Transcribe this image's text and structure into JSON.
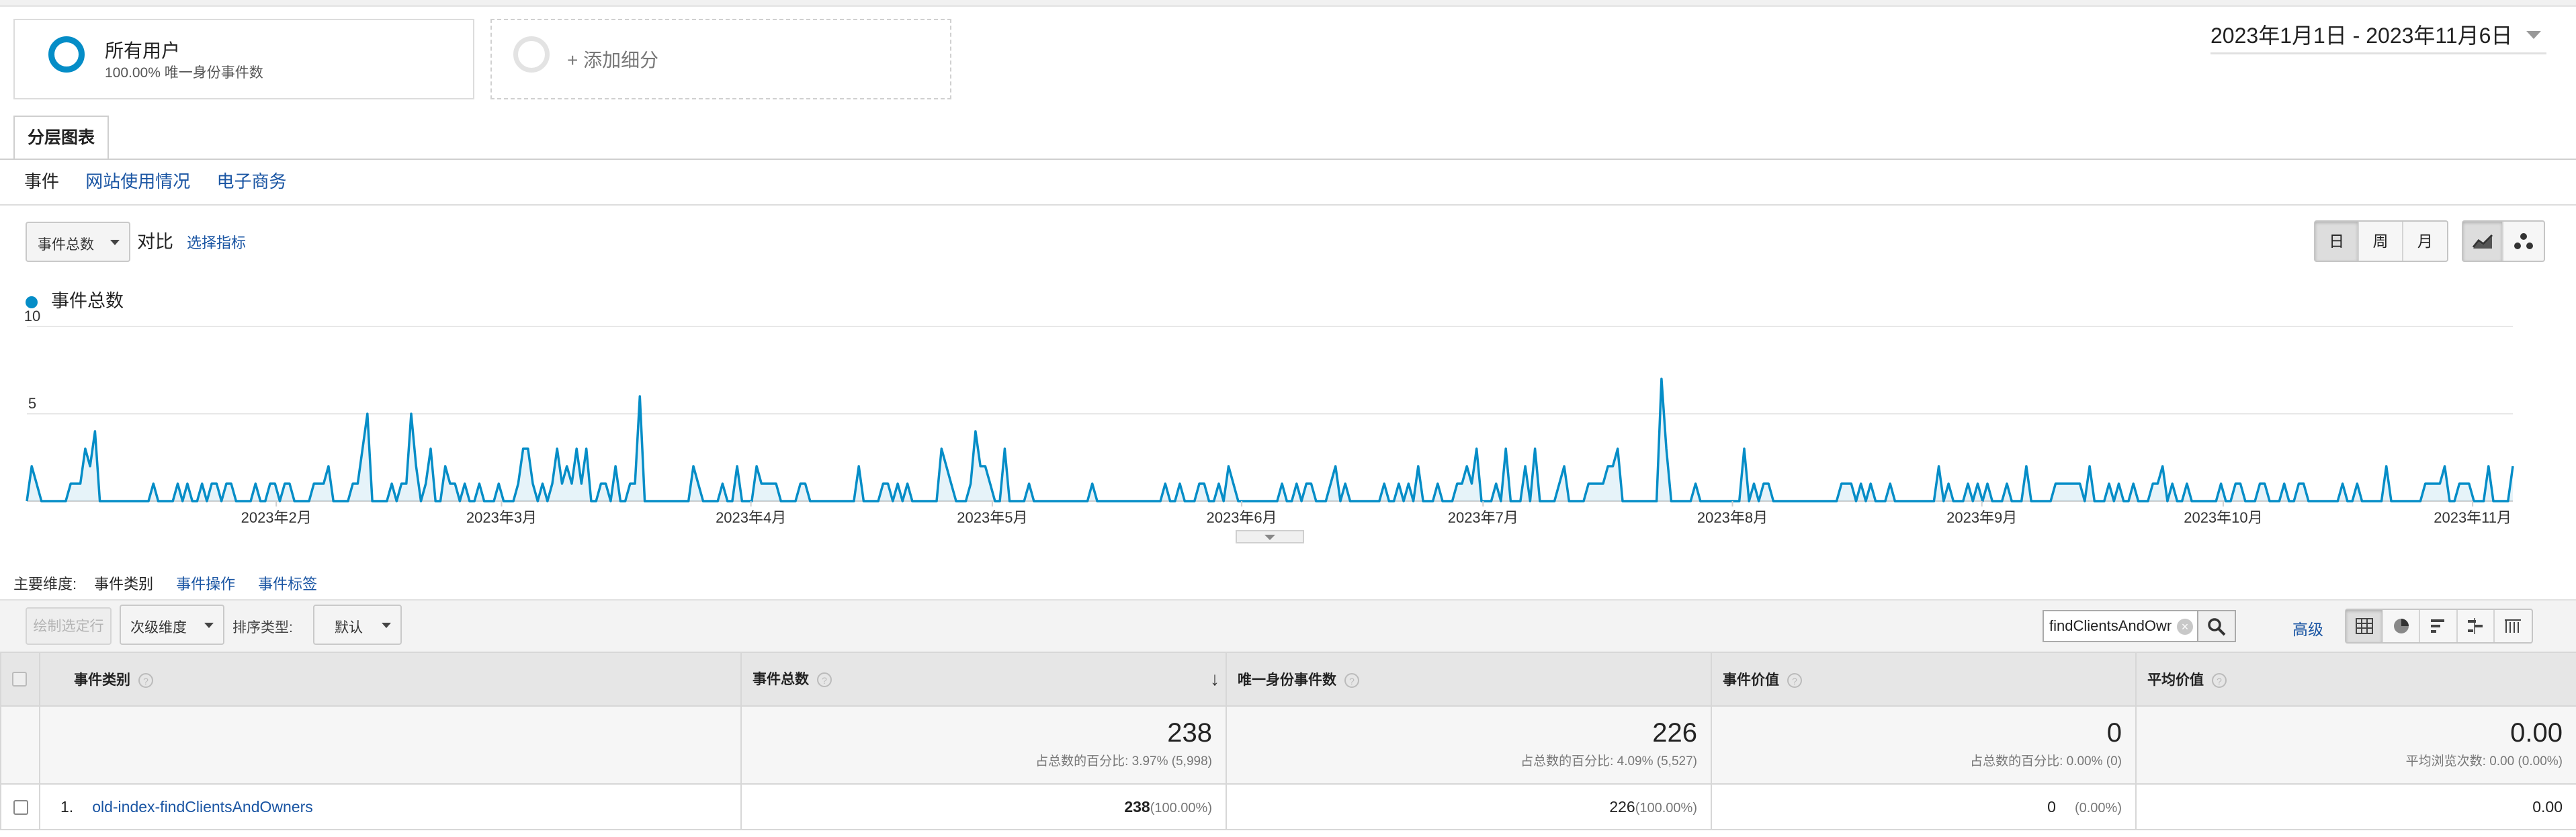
{
  "segments": {
    "active": {
      "name": "所有用户",
      "subtitle": "100.00% 唯一身份事件数"
    },
    "add_label": "+ 添加细分"
  },
  "date_range": "2023年1月1日 - 2023年11月6日",
  "tabs": [
    "分层图表"
  ],
  "subnav": [
    "事件",
    "网站使用情况",
    "电子商务"
  ],
  "chart_controls": {
    "metric": "事件总数",
    "vs_label": "对比",
    "select_metric": "选择指标",
    "granularity": [
      "日",
      "周",
      "月"
    ],
    "granularity_selected": "日"
  },
  "chart_data": {
    "type": "area",
    "series": [
      {
        "name": "事件总数",
        "color": "#058dc7",
        "values": [
          0,
          2,
          1,
          0,
          0,
          0,
          0,
          0,
          0,
          1,
          1,
          1,
          3,
          2,
          4,
          0,
          0,
          0,
          0,
          0,
          0,
          0,
          0,
          0,
          0,
          0,
          1,
          0,
          0,
          0,
          0,
          1,
          0,
          1,
          0,
          0,
          1,
          0,
          1,
          1,
          0,
          1,
          1,
          0,
          0,
          0,
          0,
          1,
          0,
          0,
          1,
          1,
          0,
          1,
          1,
          0,
          0,
          0,
          0,
          1,
          1,
          1,
          2,
          0,
          0,
          0,
          0,
          1,
          1,
          3,
          5,
          0,
          0,
          0,
          0,
          1,
          0,
          1,
          1,
          5,
          2,
          0,
          1,
          3,
          0,
          0,
          2,
          1,
          1,
          0,
          1,
          0,
          0,
          1,
          0,
          0,
          0,
          1,
          0,
          0,
          0,
          1,
          3,
          3,
          1,
          0,
          1,
          0,
          1,
          3,
          1,
          2,
          1,
          3,
          1,
          3,
          0,
          0,
          1,
          1,
          0,
          2,
          0,
          0,
          1,
          1,
          6,
          0,
          0,
          0,
          0,
          0,
          0,
          0,
          0,
          0,
          0,
          2,
          1,
          0,
          0,
          0,
          0,
          1,
          0,
          0,
          2,
          0,
          0,
          0,
          2,
          1,
          1,
          1,
          1,
          0,
          0,
          0,
          0,
          1,
          1,
          0,
          0,
          0,
          0,
          0,
          0,
          0,
          0,
          0,
          0,
          2,
          0,
          0,
          0,
          0,
          1,
          1,
          0,
          1,
          0,
          1,
          0,
          0,
          0,
          0,
          0,
          0,
          3,
          2,
          1,
          0,
          0,
          0,
          1,
          4,
          2,
          2,
          1,
          0,
          0,
          3,
          0,
          0,
          0,
          0,
          1,
          0,
          0,
          0,
          0,
          0,
          0,
          0,
          0,
          0,
          0,
          0,
          0,
          1,
          0,
          0,
          0,
          0,
          0,
          0,
          0,
          0,
          0,
          0,
          0,
          0,
          0,
          0,
          1,
          0,
          0,
          1,
          0,
          0,
          0,
          1,
          1,
          0,
          0,
          1,
          0,
          2,
          1,
          0,
          0,
          0,
          0,
          0,
          0,
          0,
          0,
          0,
          1,
          0,
          0,
          1,
          0,
          1,
          1,
          0,
          0,
          0,
          1,
          2,
          0,
          1,
          0,
          0,
          0,
          0,
          0,
          0,
          0,
          1,
          0,
          0,
          1,
          0,
          1,
          0,
          2,
          0,
          0,
          0,
          1,
          0,
          0,
          0,
          1,
          1,
          2,
          1,
          3,
          0,
          0,
          0,
          1,
          0,
          3,
          0,
          0,
          0,
          2,
          0,
          3,
          0,
          0,
          0,
          0,
          1,
          2,
          0,
          0,
          0,
          0,
          1,
          1,
          1,
          1,
          2,
          2,
          3,
          0,
          0,
          0,
          0,
          0,
          0,
          0,
          0,
          7,
          3,
          0,
          0,
          0,
          0,
          0,
          1,
          0,
          0,
          0,
          0,
          0,
          0,
          0,
          0,
          0,
          3,
          0,
          1,
          0,
          1,
          1,
          0,
          0,
          0,
          0,
          0,
          0,
          0,
          0,
          0,
          0,
          0,
          0,
          0,
          0,
          1,
          1,
          1,
          0,
          1,
          0,
          1,
          0,
          0,
          0,
          1,
          0,
          0,
          0,
          0,
          0,
          0,
          0,
          0,
          0,
          2,
          0,
          1,
          0,
          0,
          0,
          1,
          0,
          1,
          0,
          1,
          0,
          0,
          0,
          1,
          0,
          0,
          0,
          2,
          0,
          0,
          0,
          0,
          0,
          1,
          1,
          1,
          1,
          1,
          1,
          0,
          2,
          0,
          0,
          0,
          1,
          0,
          1,
          0,
          0,
          1,
          0,
          0,
          0,
          1,
          1,
          2,
          0,
          1,
          0,
          0,
          1,
          0,
          0,
          0,
          0,
          0,
          0,
          1,
          0,
          0,
          1,
          1,
          0,
          0,
          0,
          1,
          1,
          0,
          0,
          0,
          1,
          0,
          0,
          1,
          1,
          0,
          0,
          0,
          0,
          0,
          0,
          0,
          1,
          0,
          0,
          1,
          0,
          0,
          0,
          0,
          0,
          2,
          0,
          0,
          0,
          0,
          0,
          0,
          0,
          1,
          1,
          1,
          1,
          2,
          0,
          0,
          1,
          1,
          1,
          0,
          0,
          0,
          2,
          0,
          0,
          0,
          0,
          2
        ]
      }
    ],
    "x_range": [
      "2023-01-01",
      "2023-11-06"
    ],
    "ylim": [
      0,
      10
    ],
    "y_ticks": [
      5,
      10
    ],
    "x_tick_labels": [
      "2023年2月",
      "2023年3月",
      "2023年4月",
      "2023年5月",
      "2023年6月",
      "2023年7月",
      "2023年8月",
      "2023年9月",
      "2023年10月",
      "2023年11月"
    ],
    "x_tick_dates": [
      "2023-02-01",
      "2023-03-01",
      "2023-04-01",
      "2023-05-01",
      "2023-06-01",
      "2023-07-01",
      "2023-08-01",
      "2023-09-01",
      "2023-10-01",
      "2023-11-01"
    ],
    "grid": true,
    "legend": "top-left"
  },
  "dimensions": {
    "label": "主要维度:",
    "current": "事件类别",
    "others": [
      "事件操作",
      "事件标签"
    ]
  },
  "toolbar": {
    "plot_rows": "绘制选定行",
    "secondary_dim": "次级维度",
    "sort_label": "排序类型:",
    "sort_value": "默认",
    "search_value": "findClientsAndOwners",
    "advanced": "高级"
  },
  "table": {
    "headers": [
      "事件类别",
      "事件总数",
      "唯一身份事件数",
      "事件价值",
      "平均价值"
    ],
    "totals": [
      {
        "value": "238",
        "sub": "占总数的百分比: 3.97% (5,998)"
      },
      {
        "value": "226",
        "sub": "占总数的百分比: 4.09% (5,527)"
      },
      {
        "value": "0",
        "sub": "占总数的百分比: 0.00% (0)"
      },
      {
        "value": "0.00",
        "sub": "平均浏览次数: 0.00 (0.00%)"
      }
    ],
    "rows": [
      {
        "index": "1.",
        "label": "old-index-findClientsAndOwners",
        "total_events": "238",
        "total_events_pct": "(100.00%)",
        "unique_events": "226",
        "unique_events_pct": "(100.00%)",
        "event_value": "0",
        "event_value_pct": "(0.00%)",
        "avg_value": "0.00"
      }
    ]
  }
}
